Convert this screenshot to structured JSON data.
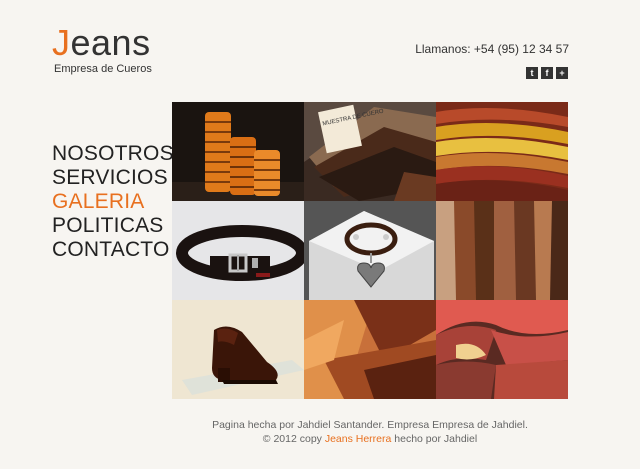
{
  "header": {
    "logo_first": "J",
    "logo_rest": "eans",
    "tagline": "Empresa de Cueros",
    "phone": "Llamanos: +54 (95) 12 34 57",
    "social": [
      "twitter-icon",
      "facebook-icon",
      "plus-icon"
    ]
  },
  "nav": {
    "items": [
      "NOSOTROS",
      "SERVICIOS",
      "GALERIA",
      "POLITICAS",
      "CONTACTO"
    ],
    "active": "GALERIA"
  },
  "gallery": {
    "photos": [
      {
        "name": "leather-rolls",
        "label": ""
      },
      {
        "name": "leather-swatches",
        "label": "MUESTRA DE CUERO"
      },
      {
        "name": "stacked-hides",
        "label": ""
      },
      {
        "name": "leather-belt",
        "label": ""
      },
      {
        "name": "leather-bracelet",
        "label": ""
      },
      {
        "name": "hanging-hides",
        "label": ""
      },
      {
        "name": "leather-shoe",
        "label": ""
      },
      {
        "name": "leather-closeup",
        "label": ""
      },
      {
        "name": "leather-pieces",
        "label": ""
      }
    ]
  },
  "footer": {
    "line1": "Pagina hecha por Jahdiel Santander. Empresa Empresa de Jahdiel.",
    "line2_pre": "© 2012 copy",
    "line2_link": "Jeans Herrera",
    "line2_post": "hecho por Jahdiel"
  },
  "colors": {
    "accent": "#e8701f",
    "text": "#333333",
    "background": "#f7f5f1"
  }
}
